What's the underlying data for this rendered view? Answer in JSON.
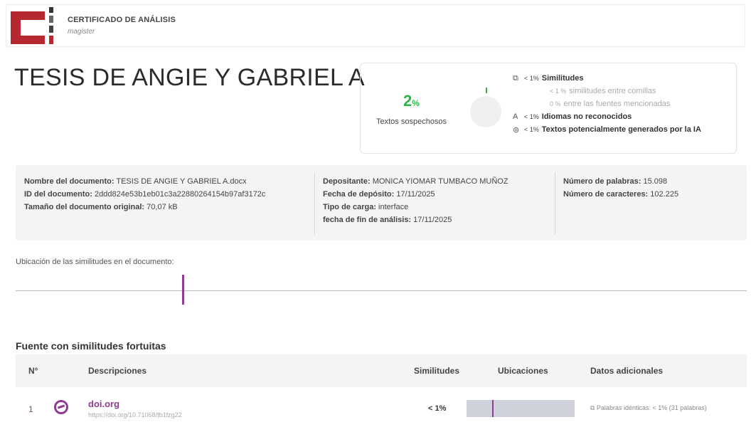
{
  "header": {
    "title": "CERTIFICADO DE ANÁLISIS",
    "subtitle": "magister"
  },
  "document_title": "TESIS DE ANGIE Y GABRIEL A",
  "summary": {
    "percent_value": "2",
    "percent_sign": "%",
    "suspicious_label": "Textos sospechosos",
    "legend": [
      {
        "icon": "copy-icon",
        "glyph": "⧉",
        "pct": "< 1%",
        "label": "Similitudes",
        "sub": false
      },
      {
        "icon": "",
        "glyph": "",
        "pct": "< 1 %",
        "label": "similitudes entre comillas",
        "sub": true
      },
      {
        "icon": "",
        "glyph": "",
        "pct": "0 %",
        "label": "entre las fuentes mencionadas",
        "sub": true
      },
      {
        "icon": "language-icon",
        "glyph": "A",
        "pct": "< 1%",
        "label": "Idiomas no reconocidos",
        "sub": false
      },
      {
        "icon": "ai-icon",
        "glyph": "⊜",
        "pct": "< 1%",
        "label": "Textos potencialmente generados por la IA",
        "sub": false
      }
    ]
  },
  "info": {
    "col1": [
      {
        "k": "Nombre del documento:",
        "v": "TESIS DE ANGIE Y GABRIEL A.docx"
      },
      {
        "k": "ID del documento:",
        "v": "2ddd824e53b1eb01c3a22880264154b97af3172c"
      },
      {
        "k": "Tamaño del documento original:",
        "v": "70,07 kB"
      }
    ],
    "col2": [
      {
        "k": "Depositante:",
        "v": "MONICA YIOMAR TUMBACO MUÑOZ"
      },
      {
        "k": "Fecha de depósito:",
        "v": "17/11/2025"
      },
      {
        "k": "Tipo de carga:",
        "v": "interface"
      },
      {
        "k": "fecha de fin de análisis:",
        "v": "17/11/2025"
      }
    ],
    "col3": [
      {
        "k": "Número de palabras:",
        "v": "15.098"
      },
      {
        "k": "Número de caracteres:",
        "v": "102.225"
      }
    ]
  },
  "location": {
    "label": "Ubicación de las similitudes en el documento:"
  },
  "sources": {
    "title": "Fuente con similitudes fortuitas",
    "headers": {
      "num": "N°",
      "desc": "Descripciones",
      "sim": "Similitudes",
      "ubi": "Ubicaciones",
      "extra": "Datos adicionales"
    },
    "rows": [
      {
        "num": "1",
        "name": "doi.org",
        "url": "https://doi.org/10.71068/fb1fzg22",
        "sim": "< 1%",
        "extra": "⧉ Palabras idénticas: < 1% (31 palabras)"
      }
    ]
  }
}
